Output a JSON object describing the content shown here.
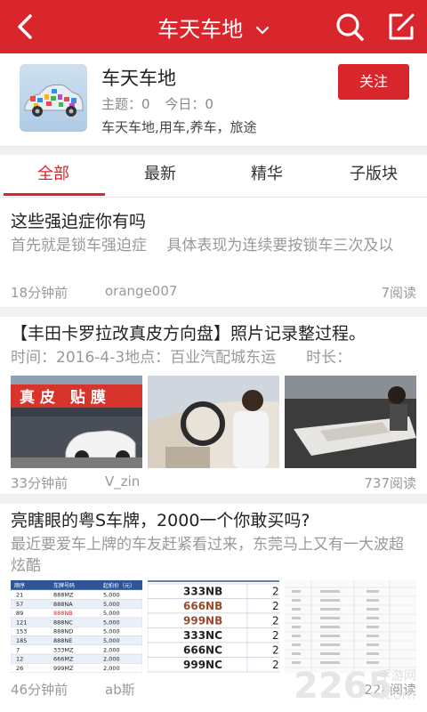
{
  "topbar": {
    "title": "车天车地",
    "back_icon": "arrow-left-icon",
    "search_icon": "search-icon",
    "compose_icon": "compose-icon",
    "bg_color": "#d9262c"
  },
  "forum": {
    "name": "车天车地",
    "topics_label": "主题：0",
    "today_label": "今日：0",
    "description": "车天车地,用车,养车，旅途",
    "follow_label": "关注"
  },
  "tabs": [
    {
      "label": "全部",
      "active": true
    },
    {
      "label": "最新",
      "active": false
    },
    {
      "label": "精华",
      "active": false
    },
    {
      "label": "子版块",
      "active": false
    }
  ],
  "posts": [
    {
      "title": "这些强迫症你有吗",
      "summary": "首先就是锁车强迫症　 具体表现为连续要按锁车三次及以",
      "time": "18分钟前",
      "author": "orange007",
      "reads": "7阅读"
    },
    {
      "title": "【丰田卡罗拉改真皮方向盘】照片记录整过程。",
      "summary": "时间：2016-4-3地点：百业汽配城东运　　时长：",
      "time": "33分钟前",
      "author": "V_zin",
      "reads": "737阅读",
      "shop_sign": "真 皮　贴 膜"
    },
    {
      "title": "亮瞎眼的粤S车牌，2000一个你敢买吗?",
      "summary": "最近要爱车上牌的车友赶紧看过来，东莞马上又有一大波超炫酷",
      "time": "46分钟前",
      "author": "ab斯",
      "reads": "228阅读",
      "table1": {
        "headers": [
          "顺序",
          "车牌号码",
          "起拍价（元）"
        ],
        "rows": [
          [
            "21",
            "888MZ",
            "5,000"
          ],
          [
            "57",
            "888NA",
            "5,000"
          ],
          [
            "89",
            "888NB",
            "5,000"
          ],
          [
            "121",
            "888NC",
            "5,000"
          ],
          [
            "153",
            "888ND",
            "5,000"
          ],
          [
            "185",
            "888NE",
            "5,000"
          ],
          [
            "7",
            "333MZ",
            "2,000"
          ],
          [
            "12",
            "666MZ",
            "2,000"
          ],
          [
            "26",
            "999MZ",
            "2,000"
          ]
        ]
      },
      "table2": {
        "plates": [
          "333NB",
          "666NB",
          "999NB",
          "333NC",
          "666NC",
          "999NC"
        ]
      }
    }
  ],
  "watermark": {
    "number": "2265",
    "suffix": ".com",
    "site": "手游网"
  }
}
